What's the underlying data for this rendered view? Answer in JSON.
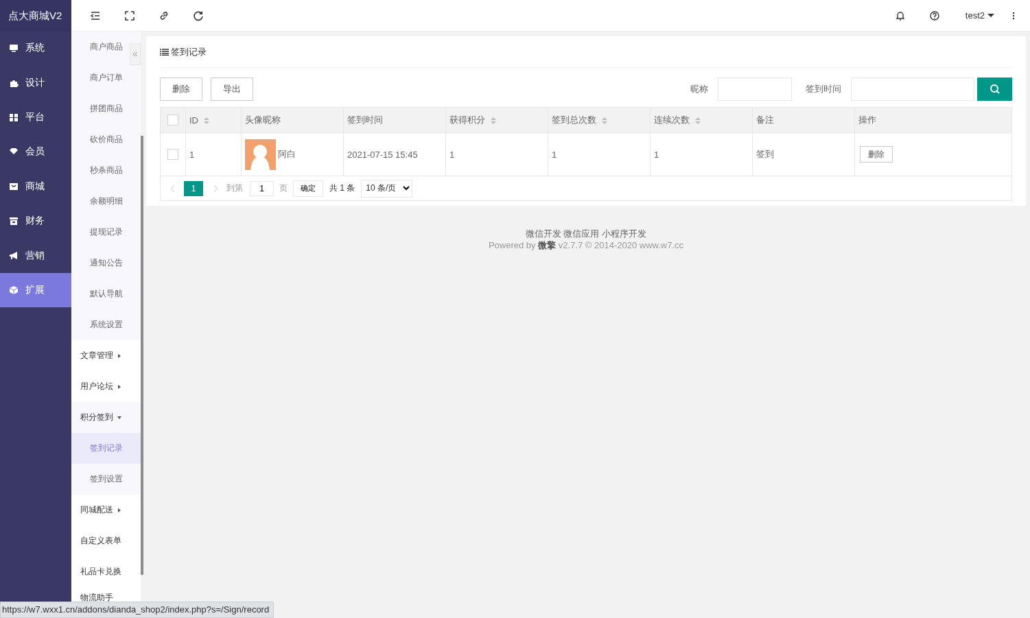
{
  "brand": "点大商城V2",
  "nav": [
    {
      "label": "系统",
      "selected": false
    },
    {
      "label": "设计",
      "selected": false
    },
    {
      "label": "平台",
      "selected": false
    },
    {
      "label": "会员",
      "selected": false
    },
    {
      "label": "商城",
      "selected": false
    },
    {
      "label": "财务",
      "selected": false
    },
    {
      "label": "营销",
      "selected": false
    },
    {
      "label": "扩展",
      "selected": true
    }
  ],
  "submenu": [
    {
      "children": [
        {
          "label": "商户商品",
          "selected": false
        },
        {
          "label": "商户订单",
          "selected": false
        },
        {
          "label": "拼团商品",
          "selected": false
        },
        {
          "label": "砍价商品",
          "selected": false
        },
        {
          "label": "秒杀商品",
          "selected": false
        },
        {
          "label": "余额明细",
          "selected": false
        },
        {
          "label": "提现记录",
          "selected": false
        },
        {
          "label": "通知公告",
          "selected": false
        },
        {
          "label": "默认导航",
          "selected": false
        },
        {
          "label": "系统设置",
          "selected": false
        }
      ]
    },
    {
      "label": "文章管理",
      "expanded": false
    },
    {
      "label": "用户论坛",
      "expanded": false
    },
    {
      "label": "积分签到",
      "expanded": true,
      "children": [
        {
          "label": "签到记录",
          "selected": true
        },
        {
          "label": "签到设置",
          "selected": false
        }
      ]
    },
    {
      "label": "同城配送",
      "expanded": false
    },
    {
      "label": "自定义表单"
    },
    {
      "label": "礼品卡兑换"
    },
    {
      "label": "物流助手"
    }
  ],
  "topbar": {
    "user": "test2"
  },
  "panel": {
    "title": "签到记录",
    "buttons": [
      "删除",
      "导出"
    ],
    "filters": [
      {
        "label": "昵称"
      },
      {
        "label": "签到时间"
      }
    ],
    "table": {
      "all_checked": false,
      "columns": [
        {
          "label": "ID",
          "sortable": true
        },
        {
          "label": "头像昵称",
          "sortable": false
        },
        {
          "label": "签到时间",
          "sortable": false
        },
        {
          "label": "获得积分",
          "sortable": true
        },
        {
          "label": "签到总次数",
          "sortable": true
        },
        {
          "label": "连续次数",
          "sortable": true
        },
        {
          "label": "备注",
          "sortable": false
        },
        {
          "label": "操作",
          "sortable": false
        }
      ],
      "rows": [
        {
          "checked": false,
          "id": "1",
          "nickname": "阿白",
          "time": "2021-07-15 15:45",
          "points": "1",
          "total": "1",
          "streak": "1",
          "remark": "签到",
          "action": "删除"
        }
      ]
    },
    "pager": {
      "current": "1",
      "goto_label": "到第",
      "goto_value": "1",
      "page_unit": "页",
      "confirm": "确定",
      "total": "共 1 条",
      "page_size": "10 条/页"
    }
  },
  "footer": {
    "links": "微信开发 微信应用 小程序开发",
    "powered": "Powered by **微擎** v2.7.7 © 2014-2020 www.w7.cc"
  },
  "status_url": "https://w7.wxx1.cn/addons/dianda_shop2/index.php?s=/Sign/record"
}
